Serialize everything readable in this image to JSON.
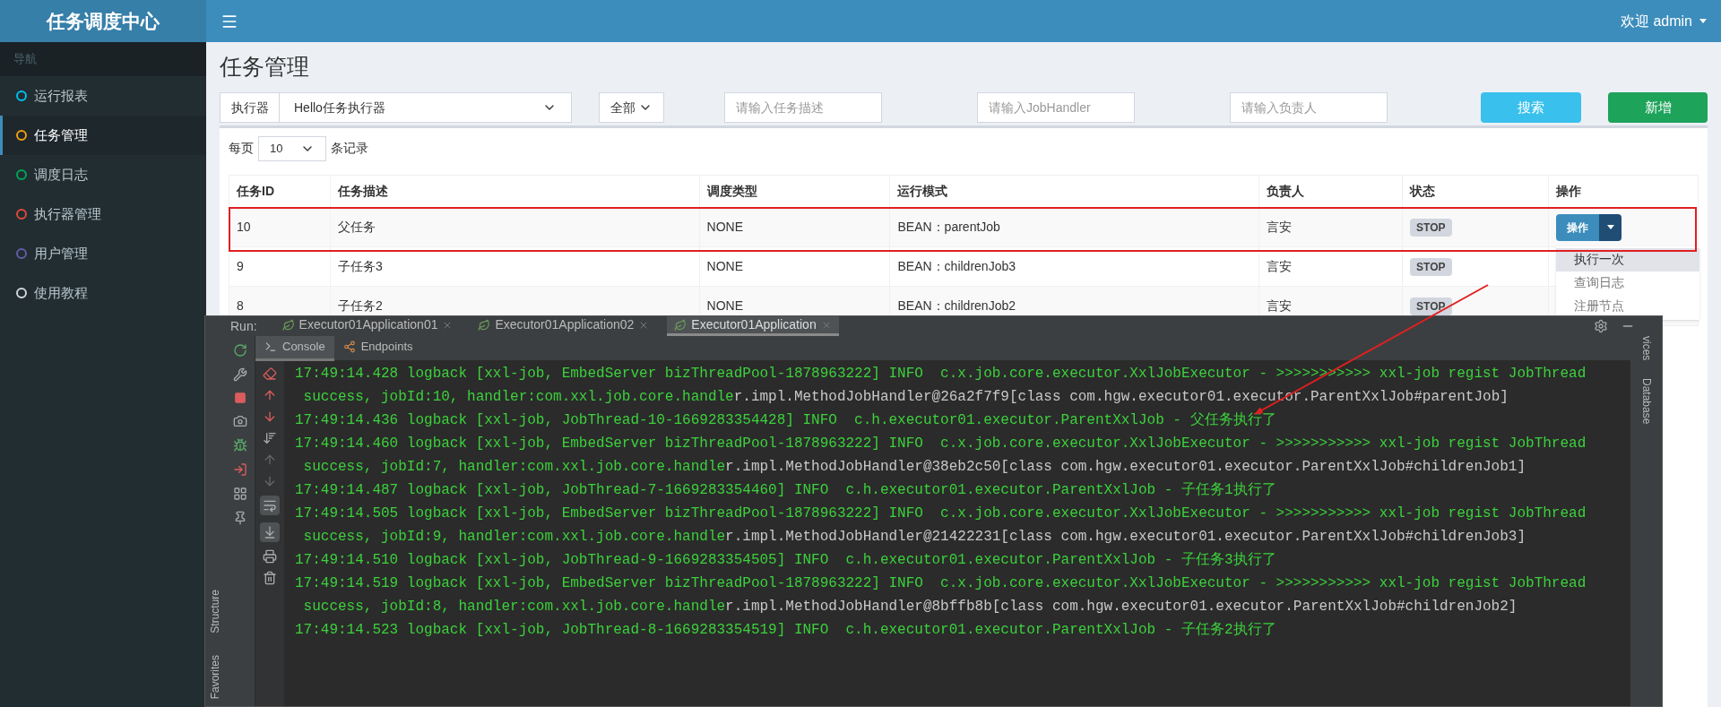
{
  "header": {
    "logo": "任务调度中心",
    "user_menu": "欢迎 admin"
  },
  "sidebar": {
    "heading": "导航",
    "items": [
      {
        "label": "运行报表",
        "color": "#00c0ef",
        "selected": false
      },
      {
        "label": "任务管理",
        "color": "#f39c12",
        "selected": true
      },
      {
        "label": "调度日志",
        "color": "#00a65a",
        "selected": false
      },
      {
        "label": "执行器管理",
        "color": "#dd4b39",
        "selected": false
      },
      {
        "label": "用户管理",
        "color": "#605ca8",
        "selected": false
      },
      {
        "label": "使用教程",
        "color": "#d2d6de",
        "selected": false
      }
    ]
  },
  "page_title": "任务管理",
  "filters": {
    "executor_label": "执行器",
    "executor_value": "Hello任务执行器",
    "status_value": "全部",
    "description_placeholder": "请输入任务描述",
    "handler_placeholder": "请输入JobHandler",
    "owner_placeholder": "请输入负责人",
    "search_button": "搜索",
    "add_button": "新增"
  },
  "page_size": {
    "before": "每页",
    "value": "10",
    "after": "条记录"
  },
  "table": {
    "columns": [
      "任务ID",
      "任务描述",
      "调度类型",
      "运行模式",
      "负责人",
      "状态",
      "操作"
    ],
    "rows": [
      {
        "id": "10",
        "description": "父任务",
        "schedule_type": "NONE",
        "run_mode": "BEAN：parentJob",
        "owner": "言安",
        "status": "STOP",
        "action": "操作"
      },
      {
        "id": "9",
        "description": "子任务3",
        "schedule_type": "NONE",
        "run_mode": "BEAN：childrenJob3",
        "owner": "言安",
        "status": "STOP"
      },
      {
        "id": "8",
        "description": "子任务2",
        "schedule_type": "NONE",
        "run_mode": "BEAN：childrenJob2",
        "owner": "言安",
        "status": "STOP"
      }
    ]
  },
  "action_menu": [
    {
      "label": "执行一次",
      "highlighted": true
    },
    {
      "label": "查询日志",
      "highlighted": false
    },
    {
      "label": "注册节点",
      "highlighted": false
    }
  ],
  "ide": {
    "run_label": "Run:",
    "tabs": [
      {
        "label": "Executor01Application01",
        "selected": false
      },
      {
        "label": "Executor01Application02",
        "selected": false
      },
      {
        "label": "Executor01Application",
        "selected": true
      }
    ],
    "subtabs": [
      {
        "label": "Console",
        "selected": true
      },
      {
        "label": "Endpoints",
        "selected": false
      }
    ],
    "toggles": {
      "soft_wrap_on": true,
      "scroll_to_end_on": true
    },
    "left_panels": [
      "Structure",
      "Favorites"
    ],
    "right_panels": [
      "vices",
      "Database"
    ],
    "console": [
      {
        "parts": [
          {
            "text": "17:49:14.428 logback [xxl-job, EmbedServer bizThreadPool-1878963222] INFO  c.x.job.core.executor.XxlJobExecutor - >>>>>>>>>>> xxl-job regist JobThread",
            "highlighted": true
          }
        ]
      },
      {
        "parts": [
          {
            "text": " success, jobId:10, handler:com.xxl.job.core.handle",
            "highlighted": true
          },
          {
            "text": "r.impl.MethodJobHandler@26a2f7f9[class com.hgw.executor01.executor.ParentXxlJob#parentJob]",
            "highlighted": false
          }
        ]
      },
      {
        "parts": [
          {
            "text": "17:49:14.436 logback [xxl-job, JobThread-10-1669283354428] INFO  c.h.executor01.executor.ParentXxlJob - 父任务执行了",
            "highlighted": true
          }
        ]
      },
      {
        "parts": [
          {
            "text": "17:49:14.460 logback [xxl-job, EmbedServer bizThreadPool-1878963222] INFO  c.x.job.core.executor.XxlJobExecutor - >>>>>>>>>>> xxl-job regist JobThread",
            "highlighted": true
          }
        ]
      },
      {
        "parts": [
          {
            "text": " success, jobId:7, handler:com.xxl.job.core.handle",
            "highlighted": true
          },
          {
            "text": "r.impl.MethodJobHandler@38eb2c50[class com.hgw.executor01.executor.ParentXxlJob#childrenJob1]",
            "highlighted": false
          }
        ]
      },
      {
        "parts": [
          {
            "text": "17:49:14.487 logback [xxl-job, JobThread-7-1669283354460] INFO  c.h.executor01.executor.ParentXxlJob - 子任务1执行了",
            "highlighted": true
          }
        ]
      },
      {
        "parts": [
          {
            "text": "17:49:14.505 logback [xxl-job, EmbedServer bizThreadPool-1878963222] INFO  c.x.job.core.executor.XxlJobExecutor - >>>>>>>>>>> xxl-job regist JobThread",
            "highlighted": true
          }
        ]
      },
      {
        "parts": [
          {
            "text": " success, jobId:9, handler:com.xxl.job.core.handle",
            "highlighted": true
          },
          {
            "text": "r.impl.MethodJobHandler@21422231[class com.hgw.executor01.executor.ParentXxlJob#childrenJob3]",
            "highlighted": false
          }
        ]
      },
      {
        "parts": [
          {
            "text": "17:49:14.510 logback [xxl-job, JobThread-9-1669283354505] INFO  c.h.executor01.executor.ParentXxlJob - 子任务3执行了",
            "highlighted": true
          }
        ]
      },
      {
        "parts": [
          {
            "text": "17:49:14.519 logback [xxl-job, EmbedServer bizThreadPool-1878963222] INFO  c.x.job.core.executor.XxlJobExecutor - >>>>>>>>>>> xxl-job regist JobThread",
            "highlighted": true
          }
        ]
      },
      {
        "parts": [
          {
            "text": " success, jobId:8, handler:com.xxl.job.core.handle",
            "highlighted": true
          },
          {
            "text": "r.impl.MethodJobHandler@8bffb8b[class com.hgw.executor01.executor.ParentXxlJob#childrenJob2]",
            "highlighted": false
          }
        ]
      },
      {
        "parts": [
          {
            "text": "17:49:14.523 logback [xxl-job, JobThread-8-1669283354519] INFO  c.h.executor01.executor.ParentXxlJob - 子任务2执行了",
            "highlighted": true
          }
        ]
      }
    ]
  }
}
